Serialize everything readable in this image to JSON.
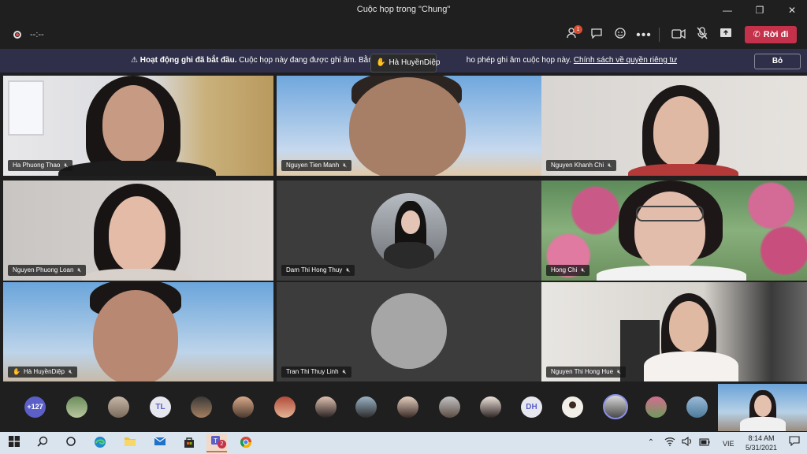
{
  "window": {
    "title": "Cuộc họp trong \"Chung\"",
    "minimize": "—",
    "maximize": "❐",
    "close": "✕"
  },
  "toolbar": {
    "timer": "--:--",
    "participants_badge": "1",
    "leave_label": "Rời đi",
    "icons": [
      "people-icon",
      "chat-icon",
      "reactions-icon",
      "more-icon",
      "camera-icon",
      "mic-off-icon",
      "share-icon",
      "phone-icon"
    ]
  },
  "banner": {
    "bold_text": "Hoạt động ghi đã bắt đầu.",
    "text_before": " Cuộc họp này đang được ghi âm. Bằng cách t",
    "text_after": "ho phép ghi âm cuộc họp này. ",
    "link": "Chính sách về quyền riêng tư",
    "dismiss_label": "Bỏ"
  },
  "raise_hand_popup": {
    "name": "Hà HuyềnDiệp"
  },
  "tiles": [
    {
      "name": "Ha Phuong Thao",
      "hand": false
    },
    {
      "name": "Nguyen Tien Manh",
      "hand": false
    },
    {
      "name": "Nguyen Khanh Chi",
      "hand": false
    },
    {
      "name": "Nguyen Phuong Loan",
      "hand": false
    },
    {
      "name": "Dam Thi Hong Thuy",
      "hand": false
    },
    {
      "name": "Hong Chi",
      "hand": false
    },
    {
      "name": "Hà HuyềnDiệp",
      "hand": true
    },
    {
      "name": "Tran Thi Thuy Linh",
      "hand": false
    },
    {
      "name": "Nguyen Thi Hong Hue",
      "hand": false
    }
  ],
  "strip": {
    "overflow_count": "+127",
    "initials": [
      "TL",
      "DH"
    ]
  },
  "taskbar": {
    "language": "VIE",
    "time": "8:14 AM",
    "date": "5/31/2021",
    "teams_badge": "2"
  }
}
